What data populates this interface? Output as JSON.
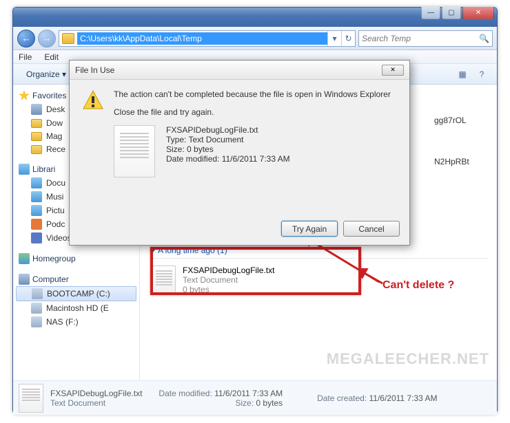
{
  "titlebar": {
    "min": "—",
    "max": "▢",
    "close": "✕"
  },
  "nav": {
    "back": "←",
    "fwd": "→",
    "path": "C:\\Users\\kk\\AppData\\Local\\Temp",
    "refresh": "↻",
    "dd": "▾",
    "search_placeholder": "Search Temp",
    "search_icon": "🔍"
  },
  "menu": {
    "file": "File",
    "edit": "Edit"
  },
  "toolbar": {
    "organize": "Organize ▾",
    "view": "▦",
    "help": "?"
  },
  "sidebar": {
    "fav": "Favorites",
    "fav_items": [
      "Desk",
      "Dow",
      "Mag",
      "Rece"
    ],
    "lib": "Librari",
    "lib_items": [
      "Docu",
      "Musi",
      "Pictu",
      "Podc",
      "Videos"
    ],
    "hg": "Homegroup",
    "comp": "Computer",
    "comp_items": [
      "BOOTCAMP (C:)",
      "Macintosh HD (E",
      "NAS (F:)"
    ]
  },
  "content": {
    "group": "A long time ago (1)",
    "file": {
      "name": "FXSAPIDebugLogFile.txt",
      "type": "Text Document",
      "size": "0 bytes"
    },
    "partial1": "gg87rOL",
    "partial2": "N2HpRBt"
  },
  "status": {
    "name": "FXSAPIDebugLogFile.txt",
    "type": "Text Document",
    "mod_l": "Date modified:",
    "mod_v": "11/6/2011 7:33 AM",
    "size_l": "Size:",
    "size_v": "0 bytes",
    "cre_l": "Date created:",
    "cre_v": "11/6/2011 7:33 AM"
  },
  "dialog": {
    "title": "File In Use",
    "msg1": "The action can't be completed because the file is open in Windows Explorer",
    "msg2": "Close the file and try again.",
    "f_name": "FXSAPIDebugLogFile.txt",
    "f_type": "Type: Text Document",
    "f_size": "Size: 0 bytes",
    "f_mod": "Date modified: 11/6/2011 7:33 AM",
    "try": "Try Again",
    "cancel": "Cancel"
  },
  "annot": "Can't delete ?",
  "wm": "MEGALEECHER.NET"
}
